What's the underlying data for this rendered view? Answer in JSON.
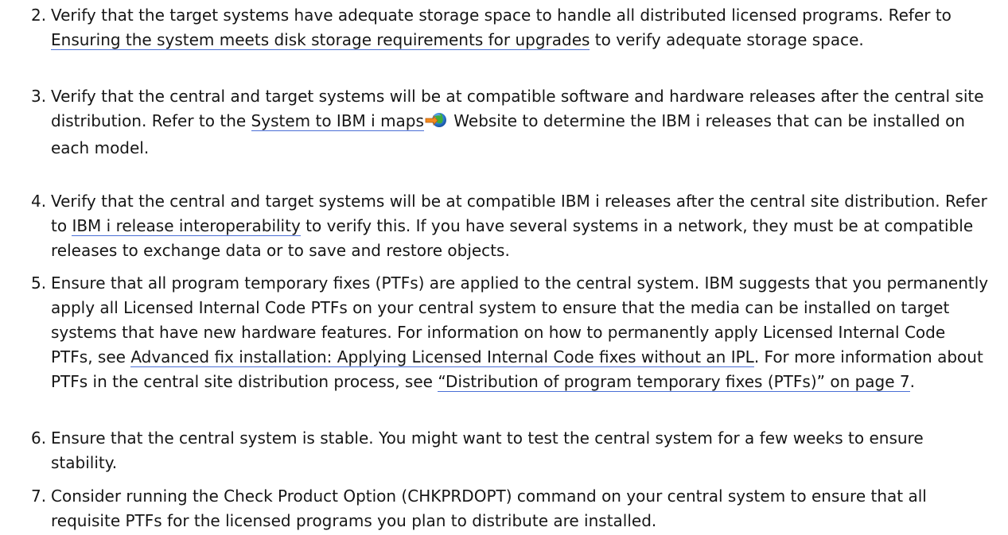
{
  "items": [
    {
      "number": "2.",
      "parts": [
        "Verify that the target systems have adequate storage space to handle all distributed licensed programs. Refer to ",
        "Ensuring the system meets disk storage requirements for upgrades",
        " to verify adequate storage space."
      ]
    },
    {
      "number": "3.",
      "parts": [
        "Verify that the central and target systems will be at compatible software and hardware releases after the central site distribution. Refer to the ",
        "System to IBM i maps",
        " Website to determine the IBM i releases that can be installed on each model."
      ]
    },
    {
      "number": "4.",
      "parts": [
        "Verify that the central and target systems will be at compatible IBM i releases after the central site distribution. Refer to ",
        "IBM i release interoperability",
        " to verify this. If you have several systems in a network, they must be at compatible releases to exchange data or to save and restore objects."
      ]
    },
    {
      "number": "5.",
      "parts": [
        "Ensure that all program temporary fixes (PTFs) are applied to the central system. IBM suggests that you permanently apply all Licensed Internal Code PTFs on your central system to ensure that the media can be installed on target systems that have new hardware features. For information on how to permanently apply Licensed Internal Code PTFs, see ",
        "Advanced fix installation: Applying Licensed Internal Code fixes without an IPL",
        ". For more information about PTFs in the central site distribution process, see ",
        "“Distribution of program temporary fixes (PTFs)” on page 7",
        "."
      ]
    },
    {
      "number": "6.",
      "parts": [
        "Ensure that the central system is stable. You might want to test the central system for a few weeks to ensure stability."
      ]
    },
    {
      "number": "7.",
      "parts": [
        "Consider running the Check Product Option (CHKPRDOPT) command on your central system to ensure that all requisite PTFs for the licensed programs you plan to distribute are installed."
      ]
    }
  ],
  "icons": {
    "external_link": "external-web-link-icon"
  },
  "colors": {
    "text": "#161616",
    "link_underline": "#4a6fd6"
  }
}
